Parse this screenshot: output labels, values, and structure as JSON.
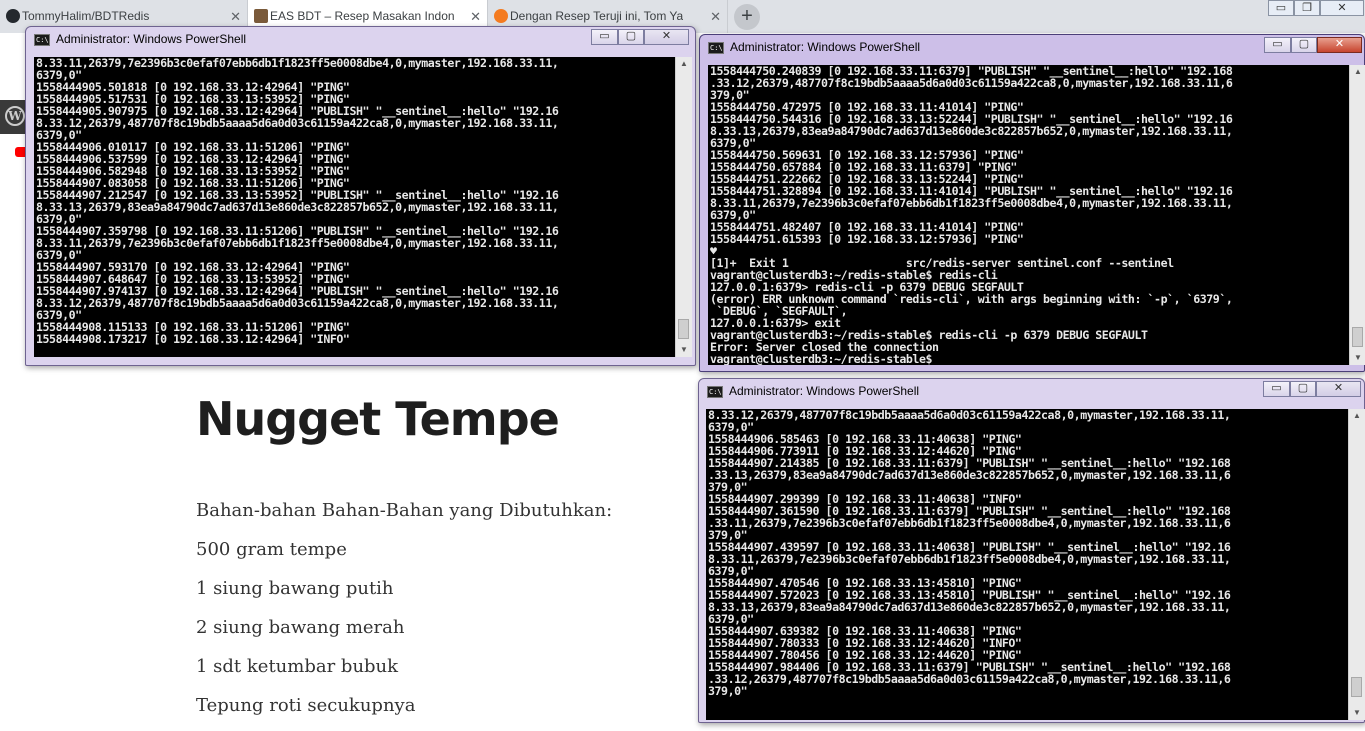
{
  "browser": {
    "tabs": [
      {
        "title": "TommyHalim/BDTRedis",
        "favicon_color": "#24292e"
      },
      {
        "title": "EAS BDT – Resep Masakan Indon",
        "favicon_color": "#7a5a3a"
      },
      {
        "title": "Dengan Resep Teruji ini, Tom Ya",
        "favicon_color": "#f47b20"
      }
    ],
    "new_tab_symbol": "+",
    "tab_close_symbol": "✕",
    "window_controls": [
      "▭",
      "❐",
      "✕"
    ]
  },
  "article": {
    "title": "Nugget Tempe",
    "lines": [
      "Bahan-bahan Bahan-Bahan yang Dibutuhkan:",
      "500 gram tempe",
      "1 siung bawang putih",
      "2 siung bawang merah",
      "1 sdt ketumbar bubuk",
      "Tepung roti secukupnya"
    ]
  },
  "powershell_windows": [
    {
      "title": "Administrator: Windows PowerShell",
      "controls": {
        "minimize": "▭",
        "maximize": "▢",
        "close": "✕"
      },
      "lines": [
        "8.33.11,26379,7e2396b3c0efaf07ebb6db1f1823ff5e0008dbe4,0,mymaster,192.168.33.11,",
        "6379,0\"",
        "1558444905.501818 [0 192.168.33.12:42964] \"PING\"",
        "1558444905.517531 [0 192.168.33.13:53952] \"PING\"",
        "1558444905.907975 [0 192.168.33.12:42964] \"PUBLISH\" \"__sentinel__:hello\" \"192.16",
        "8.33.12,26379,487707f8c19bdb5aaaa5d6a0d03c61159a422ca8,0,mymaster,192.168.33.11,",
        "6379,0\"",
        "1558444906.010117 [0 192.168.33.11:51206] \"PING\"",
        "1558444906.537599 [0 192.168.33.12:42964] \"PING\"",
        "1558444906.582948 [0 192.168.33.13:53952] \"PING\"",
        "1558444907.083058 [0 192.168.33.11:51206] \"PING\"",
        "1558444907.212547 [0 192.168.33.13:53952] \"PUBLISH\" \"__sentinel__:hello\" \"192.16",
        "8.33.13,26379,83ea9a84790dc7ad637d13e860de3c822857b652,0,mymaster,192.168.33.11,",
        "6379,0\"",
        "1558444907.359798 [0 192.168.33.11:51206] \"PUBLISH\" \"__sentinel__:hello\" \"192.16",
        "8.33.11,26379,7e2396b3c0efaf07ebb6db1f1823ff5e0008dbe4,0,mymaster,192.168.33.11,",
        "6379,0\"",
        "1558444907.593170 [0 192.168.33.12:42964] \"PING\"",
        "1558444907.648647 [0 192.168.33.13:53952] \"PING\"",
        "1558444907.974137 [0 192.168.33.12:42964] \"PUBLISH\" \"__sentinel__:hello\" \"192.16",
        "8.33.12,26379,487707f8c19bdb5aaaa5d6a0d03c61159a422ca8,0,mymaster,192.168.33.11,",
        "6379,0\"",
        "1558444908.115133 [0 192.168.33.11:51206] \"PING\"",
        "1558444908.173217 [0 192.168.33.12:42964] \"INFO\""
      ]
    },
    {
      "title": "Administrator: Windows PowerShell",
      "controls": {
        "minimize": "▭",
        "maximize": "▢",
        "close": "✕"
      },
      "lines": [
        "1558444750.240839 [0 192.168.33.11:6379] \"PUBLISH\" \"__sentinel__:hello\" \"192.168",
        ".33.12,26379,487707f8c19bdb5aaaa5d6a0d03c61159a422ca8,0,mymaster,192.168.33.11,6",
        "379,0\"",
        "1558444750.472975 [0 192.168.33.11:41014] \"PING\"",
        "1558444750.544316 [0 192.168.33.13:52244] \"PUBLISH\" \"__sentinel__:hello\" \"192.16",
        "8.33.13,26379,83ea9a84790dc7ad637d13e860de3c822857b652,0,mymaster,192.168.33.11,",
        "6379,0\"",
        "1558444750.569631 [0 192.168.33.12:57936] \"PING\"",
        "1558444750.657884 [0 192.168.33.11:6379] \"PING\"",
        "1558444751.222662 [0 192.168.33.13:52244] \"PING\"",
        "1558444751.328894 [0 192.168.33.11:41014] \"PUBLISH\" \"__sentinel__:hello\" \"192.16",
        "8.33.11,26379,7e2396b3c0efaf07ebb6db1f1823ff5e0008dbe4,0,mymaster,192.168.33.11,",
        "6379,0\"",
        "1558444751.482407 [0 192.168.33.11:41014] \"PING\"",
        "1558444751.615393 [0 192.168.33.12:57936] \"PING\"",
        "♥",
        "[1]+  Exit 1                  src/redis-server sentinel.conf --sentinel",
        "vagrant@clusterdb3:~/redis-stable$ redis-cli",
        "127.0.0.1:6379> redis-cli -p 6379 DEBUG SEGFAULT",
        "(error) ERR unknown command `redis-cli`, with args beginning with: `-p`, `6379`,",
        " `DEBUG`, `SEGFAULT`,",
        "127.0.0.1:6379> exit",
        "vagrant@clusterdb3:~/redis-stable$ redis-cli -p 6379 DEBUG SEGFAULT",
        "Error: Server closed the connection",
        "vagrant@clusterdb3:~/redis-stable$ "
      ]
    },
    {
      "title": "Administrator: Windows PowerShell",
      "controls": {
        "minimize": "▭",
        "maximize": "▢",
        "close": "✕"
      },
      "lines": [
        "8.33.12,26379,487707f8c19bdb5aaaa5d6a0d03c61159a422ca8,0,mymaster,192.168.33.11,",
        "6379,0\"",
        "1558444906.585463 [0 192.168.33.11:40638] \"PING\"",
        "1558444906.773911 [0 192.168.33.12:44620] \"PING\"",
        "1558444907.214385 [0 192.168.33.11:6379] \"PUBLISH\" \"__sentinel__:hello\" \"192.168",
        ".33.13,26379,83ea9a84790dc7ad637d13e860de3c822857b652,0,mymaster,192.168.33.11,6",
        "379,0\"",
        "1558444907.299399 [0 192.168.33.11:40638] \"INFO\"",
        "1558444907.361590 [0 192.168.33.11:6379] \"PUBLISH\" \"__sentinel__:hello\" \"192.168",
        ".33.11,26379,7e2396b3c0efaf07ebb6db1f1823ff5e0008dbe4,0,mymaster,192.168.33.11,6",
        "379,0\"",
        "1558444907.439597 [0 192.168.33.11:40638] \"PUBLISH\" \"__sentinel__:hello\" \"192.16",
        "8.33.11,26379,7e2396b3c0efaf07ebb6db1f1823ff5e0008dbe4,0,mymaster,192.168.33.11,",
        "6379,0\"",
        "1558444907.470546 [0 192.168.33.13:45810] \"PING\"",
        "1558444907.572023 [0 192.168.33.13:45810] \"PUBLISH\" \"__sentinel__:hello\" \"192.16",
        "8.33.13,26379,83ea9a84790dc7ad637d13e860de3c822857b652,0,mymaster,192.168.33.11,",
        "6379,0\"",
        "1558444907.639382 [0 192.168.33.11:40638] \"PING\"",
        "1558444907.780333 [0 192.168.33.12:44620] \"INFO\"",
        "1558444907.780456 [0 192.168.33.12:44620] \"PING\"",
        "1558444907.984406 [0 192.168.33.11:6379] \"PUBLISH\" \"__sentinel__:hello\" \"192.168",
        ".33.12,26379,487707f8c19bdb5aaaa5d6a0d03c61159a422ca8,0,mymaster,192.168.33.11,6",
        "379,0\""
      ]
    }
  ],
  "scrollbar": {
    "up": "▲",
    "down": "▼"
  }
}
